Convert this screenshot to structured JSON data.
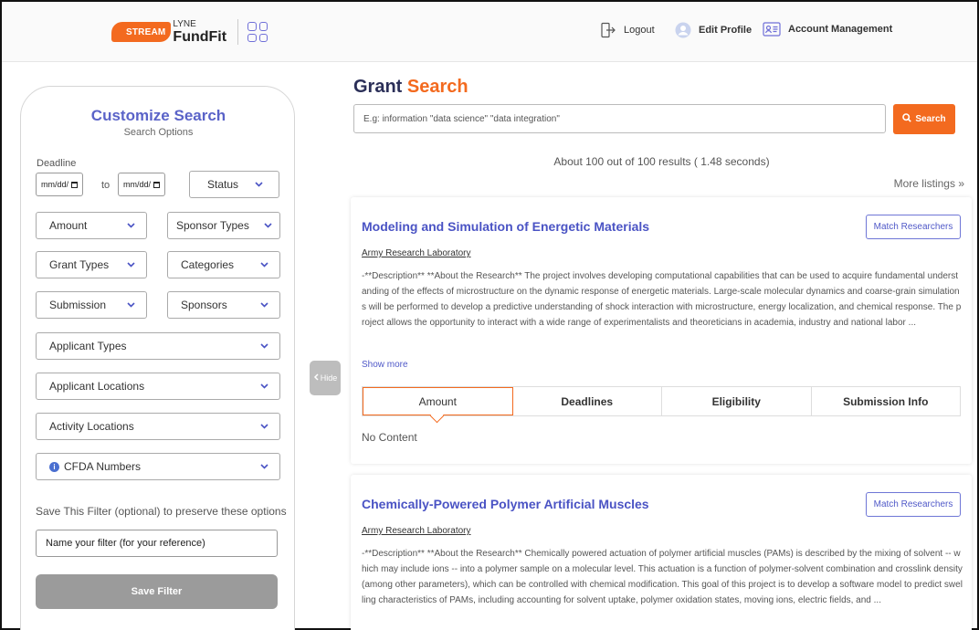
{
  "header": {
    "logo": {
      "stream": "STREAM",
      "lyne": "LYNE",
      "fundfit": "FundFit"
    },
    "nav": {
      "logout": "Logout",
      "edit_profile": "Edit Profile",
      "account_management": "Account Management"
    }
  },
  "sidebar": {
    "title": "Customize Search",
    "subtitle": "Search Options",
    "deadline_label": "Deadline",
    "date_from_placeholder": "mm/dd/",
    "date_to_placeholder": "mm/dd/",
    "date_to_word": "to",
    "filters": {
      "status": "Status",
      "amount": "Amount",
      "sponsor_types": "Sponsor Types",
      "grant_types": "Grant Types",
      "categories": "Categories",
      "submission": "Submission",
      "sponsors": "Sponsors",
      "applicant_types": "Applicant Types",
      "applicant_locations": "Applicant Locations",
      "activity_locations": "Activity Locations",
      "cfda_numbers": "CFDA Numbers"
    },
    "save_label": "Save This Filter (optional) to preserve these options",
    "filter_name_placeholder": "Name your filter (for your reference)",
    "save_button": "Save Filter",
    "hide_tab": "Hide"
  },
  "main": {
    "title_part1": "Grant ",
    "title_part2": "Search",
    "search_placeholder": "E.g: information \"data science\" \"data integration\"",
    "search_button": "Search",
    "results_count": "About 100 out of 100 results ( 1.48 seconds)",
    "more_listings": "More listings »",
    "results": [
      {
        "title": "Modeling and Simulation of Energetic Materials",
        "match_button": "Match Researchers",
        "sponsor": "Army Research Laboratory",
        "description": "-**Description** **About the Research** The project involves developing computational capabilities that can be used to acquire fundamental understanding of the effects of microstructure on the dynamic response of energetic materials. Large-scale molecular dynamics and coarse-grain simulations will be performed to develop a predictive understanding of shock interaction with microstructure, energy localization, and chemical response. The project allows the opportunity to interact with a wide range of experimentalists and theoreticians in academia, industry and national labor ...",
        "show_more": "Show more",
        "tabs": [
          "Amount",
          "Deadlines",
          "Eligibility",
          "Submission Info"
        ],
        "tab_content": "No Content"
      },
      {
        "title": "Chemically-Powered Polymer Artificial Muscles",
        "match_button": "Match Researchers",
        "sponsor": "Army Research Laboratory",
        "description": "-**Description** **About the Research** Chemically powered actuation of polymer artificial muscles (PAMs) is described by the mixing of solvent -- which may include ions -- into a polymer sample on a molecular level. This actuation is a function of polymer-solvent combination and crosslink density (among other parameters), which can be controlled with chemical modification. This goal of this project is to develop a software model to predict swelling characteristics of PAMs, including accounting for solvent uptake, polymer oxidation states, moving ions, electric fields, and ..."
      }
    ]
  },
  "colors": {
    "accent_orange": "#f36a1f",
    "brand_blue": "#5a63c8",
    "navy": "#2b2f58"
  }
}
